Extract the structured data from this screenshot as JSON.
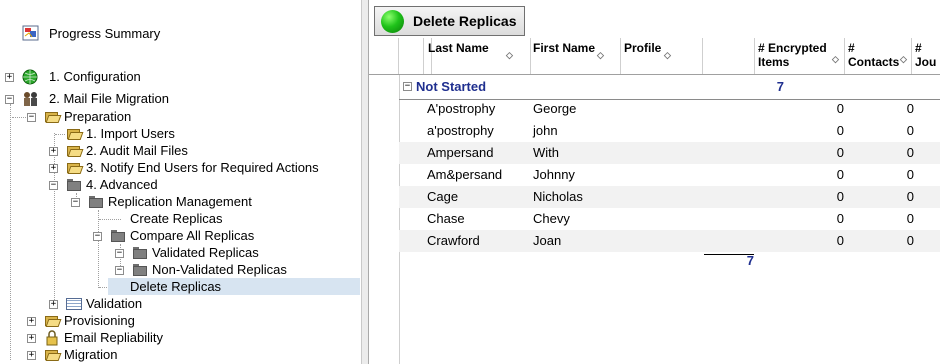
{
  "tree": {
    "summary": "Progress Summary",
    "configuration": "1. Configuration",
    "migration_root": "2. Mail File Migration",
    "preparation": "Preparation",
    "import_users": "1. Import Users",
    "audit_mail": "2. Audit Mail Files",
    "notify_users": "3. Notify End Users for Required Actions",
    "advanced": "4. Advanced",
    "replication_mgmt": "Replication Management",
    "create_replicas": "Create Replicas",
    "compare_replicas": "Compare All Replicas",
    "validated_replicas": "Validated Replicas",
    "non_validated_replicas": "Non-Validated Replicas",
    "delete_replicas": "Delete Replicas",
    "validation": "Validation",
    "provisioning": "Provisioning",
    "email_repliability": "Email Repliability",
    "migration": "Migration"
  },
  "toolbar": {
    "delete_label": "Delete Replicas"
  },
  "columns": {
    "last_name": "Last Name",
    "first_name": "First Name",
    "profile": "Profile",
    "encrypted": "# Encrypted Items",
    "contacts": "# Contacts",
    "journal": "# Jou"
  },
  "group": {
    "label": "Not Started",
    "count": "7"
  },
  "rows": [
    {
      "last": "A'postrophy",
      "first": "George",
      "enc": "0",
      "contacts": "0"
    },
    {
      "last": "a'postrophy",
      "first": "john",
      "enc": "0",
      "contacts": "0"
    },
    {
      "last": "Ampersand",
      "first": "With",
      "enc": "0",
      "contacts": "0"
    },
    {
      "last": "Am&persand",
      "first": "Johnny",
      "enc": "0",
      "contacts": "0"
    },
    {
      "last": "Cage",
      "first": "Nicholas",
      "enc": "0",
      "contacts": "0"
    },
    {
      "last": "Chase",
      "first": "Chevy",
      "enc": "0",
      "contacts": "0"
    },
    {
      "last": "Crawford",
      "first": "Joan",
      "enc": "0",
      "contacts": "0"
    }
  ],
  "total": "7",
  "colors": {
    "selection": "#d7e4f1",
    "group_text": "#1f2f8f",
    "button_green": "#1fc31a"
  }
}
